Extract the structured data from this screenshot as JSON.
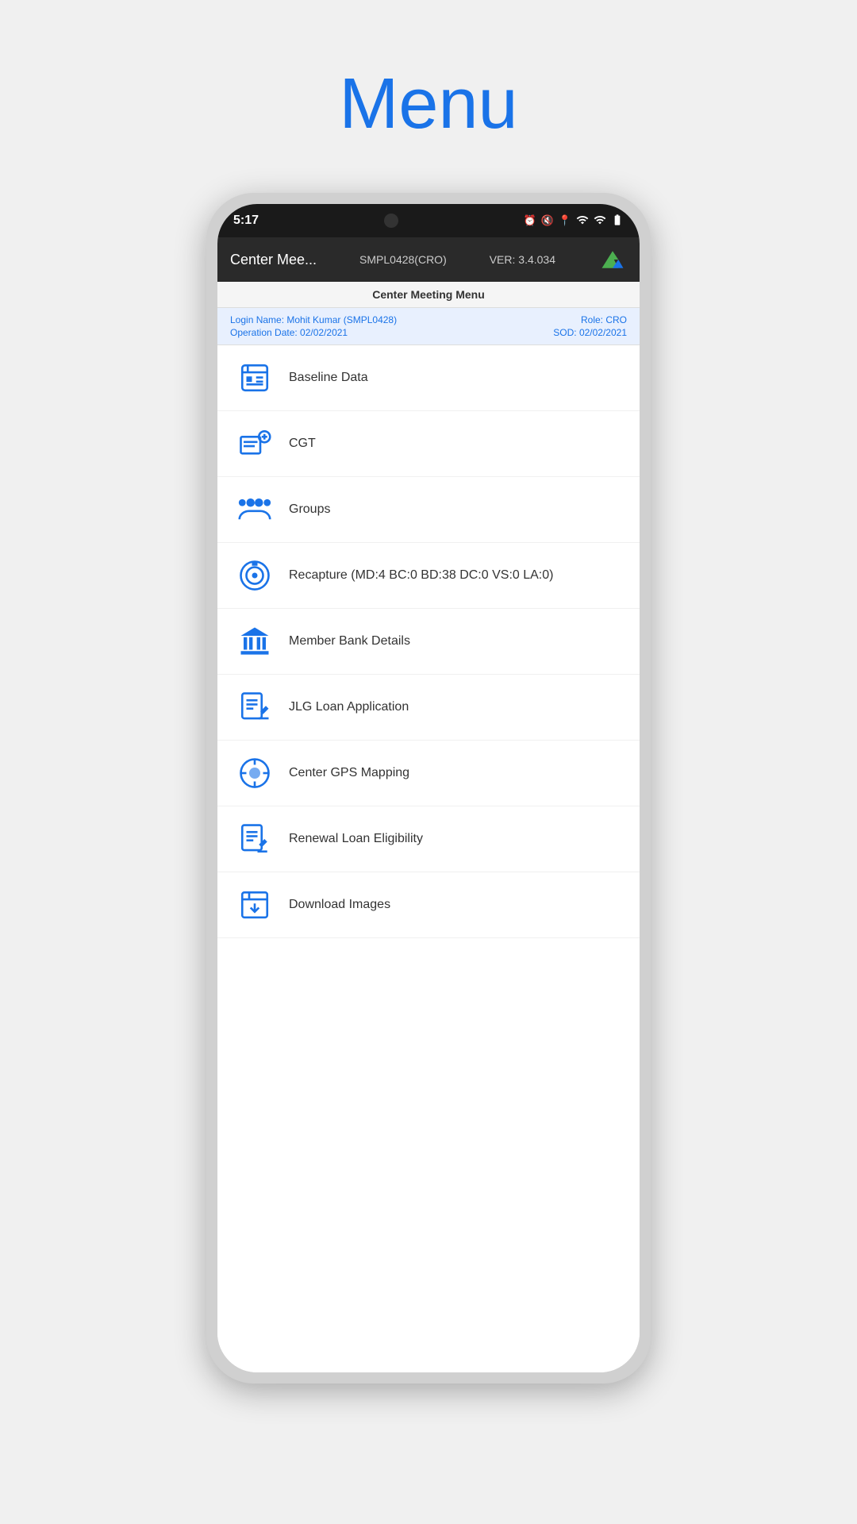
{
  "page": {
    "title": "Menu"
  },
  "status_bar": {
    "time": "5:17",
    "icons": "⏰ 🔇 📍 📶 📶 🔋"
  },
  "app_header": {
    "title": "Center Mee...",
    "user": "SMPL0428(CRO)",
    "version": "VER: 3.4.034"
  },
  "sub_header": {
    "label": "Center Meeting Menu"
  },
  "user_info": {
    "login_name_label": "Login Name: Mohit Kumar (SMPL0428)",
    "role_label": "Role: CRO",
    "operation_date_label": "Operation Date: 02/02/2021",
    "sod_label": "SOD: 02/02/2021"
  },
  "menu_items": [
    {
      "id": "baseline-data",
      "label": "Baseline Data",
      "icon": "baseline"
    },
    {
      "id": "cgt",
      "label": "CGT",
      "icon": "cgt"
    },
    {
      "id": "groups",
      "label": "Groups",
      "icon": "groups"
    },
    {
      "id": "recapture",
      "label": "Recapture (MD:4  BC:0 BD:38 DC:0 VS:0 LA:0)",
      "icon": "recapture"
    },
    {
      "id": "member-bank-details",
      "label": "Member Bank Details",
      "icon": "bank"
    },
    {
      "id": "jlg-loan-application",
      "label": "JLG Loan Application",
      "icon": "loan-app"
    },
    {
      "id": "center-gps-mapping",
      "label": "Center GPS Mapping",
      "icon": "gps"
    },
    {
      "id": "renewal-loan-eligibility",
      "label": "Renewal Loan Eligibility",
      "icon": "renewal"
    },
    {
      "id": "download-images",
      "label": "Download Images",
      "icon": "download"
    }
  ]
}
